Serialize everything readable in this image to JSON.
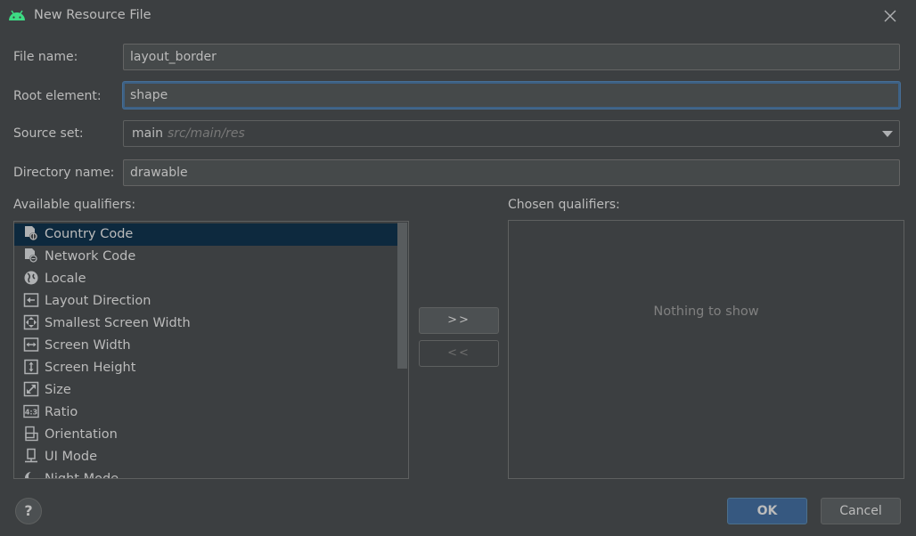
{
  "window": {
    "title": "New Resource File"
  },
  "form": {
    "file_name": {
      "label": "File name:",
      "value": "layout_border"
    },
    "root_element": {
      "label": "Root element:",
      "value": "shape"
    },
    "source_set": {
      "label": "Source set:",
      "value": "main",
      "path": "src/main/res"
    },
    "directory_name": {
      "label": "Directory name:",
      "value": "drawable"
    }
  },
  "available": {
    "label": "Available qualifiers:",
    "items": [
      {
        "label": "Country Code",
        "icon": "country-code-icon",
        "selected": true
      },
      {
        "label": "Network Code",
        "icon": "network-code-icon"
      },
      {
        "label": "Locale",
        "icon": "globe-icon"
      },
      {
        "label": "Layout Direction",
        "icon": "layout-direction-icon"
      },
      {
        "label": "Smallest Screen Width",
        "icon": "smallest-width-icon"
      },
      {
        "label": "Screen Width",
        "icon": "screen-width-icon"
      },
      {
        "label": "Screen Height",
        "icon": "screen-height-icon"
      },
      {
        "label": "Size",
        "icon": "size-icon"
      },
      {
        "label": "Ratio",
        "icon": "ratio-icon"
      },
      {
        "label": "Orientation",
        "icon": "orientation-icon"
      },
      {
        "label": "UI Mode",
        "icon": "ui-mode-icon"
      },
      {
        "label": "Night Mode",
        "icon": "night-mode-icon"
      }
    ]
  },
  "buttons": {
    "add": ">>",
    "remove": "<<",
    "ok": "OK",
    "cancel": "Cancel",
    "help": "?"
  },
  "chosen": {
    "label": "Chosen qualifiers:",
    "empty_text": "Nothing to show"
  },
  "colors": {
    "background": "#3c3f41",
    "selection": "#0d293e",
    "accent": "#365880",
    "android_green": "#3ddc84"
  }
}
